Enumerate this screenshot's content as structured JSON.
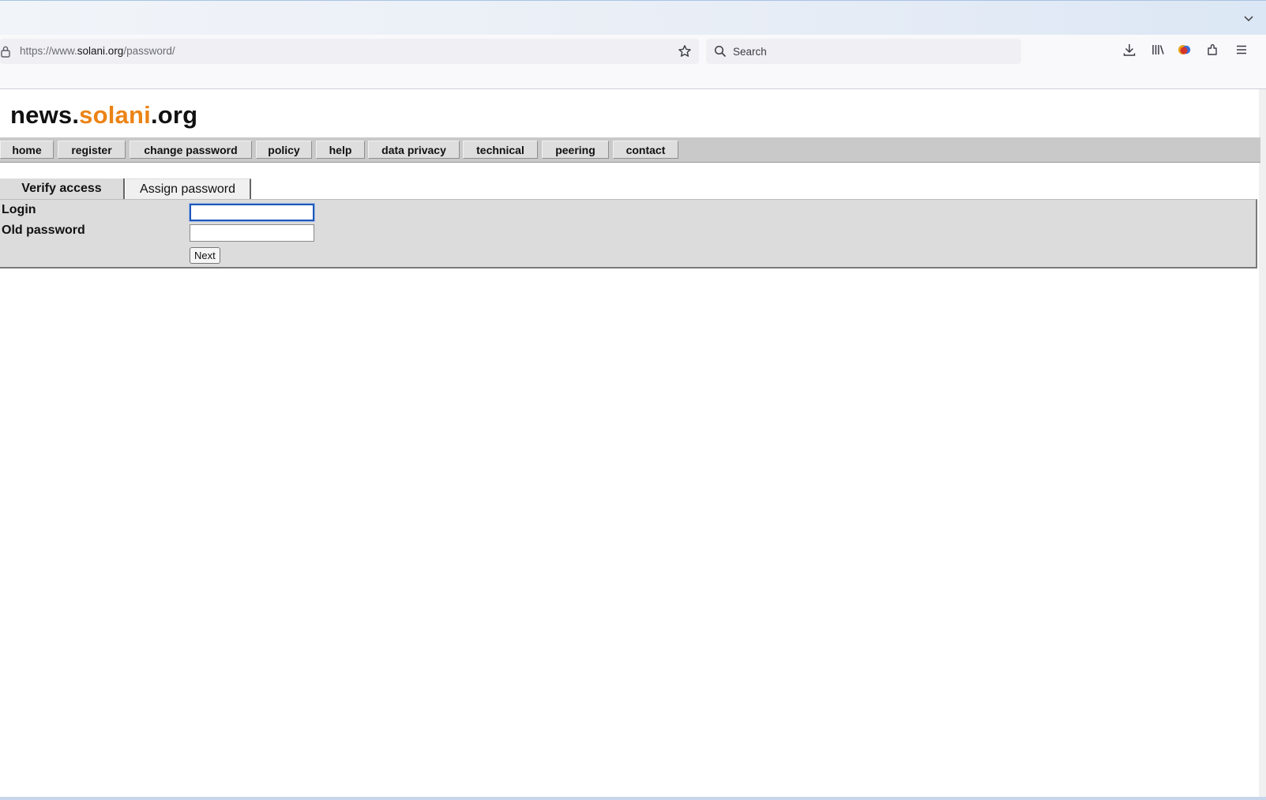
{
  "browser": {
    "url_prefix": "https://www.",
    "url_host": "solani.org",
    "url_path": "/password/",
    "search_placeholder": "Search"
  },
  "site": {
    "logo_part1": "news.",
    "logo_accent": "solani",
    "logo_part2": ".org",
    "accent_color": "#ec8316"
  },
  "nav": {
    "items": [
      "home",
      "register",
      "change password",
      "policy",
      "help",
      "data privacy",
      "technical",
      "peering",
      "contact"
    ]
  },
  "tabs": {
    "verify": "Verify access",
    "assign": "Assign password"
  },
  "form": {
    "login_label": "Login",
    "login_value": "",
    "old_password_label": "Old password",
    "old_password_value": "",
    "next_label": "Next"
  }
}
